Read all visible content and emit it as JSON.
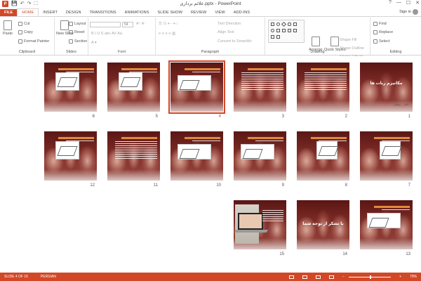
{
  "app": {
    "icon_letter": "P",
    "window_title": "علائم برداری.pptx - PowerPoint",
    "controls": [
      "?",
      "—",
      "☐",
      "✕"
    ]
  },
  "qat": [
    "💾",
    "↶",
    "↷",
    "⛶"
  ],
  "tabs": {
    "file": "FILE",
    "items": [
      "HOME",
      "INSERT",
      "DESIGN",
      "TRANSITIONS",
      "ANIMATIONS",
      "SLIDE SHOW",
      "REVIEW",
      "VIEW",
      "ADD-INS"
    ],
    "active": "HOME",
    "signin": "Sign in"
  },
  "ribbon": {
    "clipboard": {
      "label": "Clipboard",
      "paste": "Paste",
      "cut": "Cut",
      "copy": "Copy",
      "format_painter": "Format Painter"
    },
    "slides": {
      "label": "Slides",
      "new_slide": "New Slide",
      "layout": "Layout",
      "reset": "Reset",
      "section": "Section"
    },
    "font": {
      "label": "Font",
      "size": "54"
    },
    "paragraph": {
      "label": "Paragraph",
      "text_direction": "Text Direction",
      "align_text": "Align Text",
      "convert_smartart": "Convert to SmartArt"
    },
    "drawing": {
      "label": "Drawing",
      "arrange": "Arrange",
      "quick_styles": "Quick Styles",
      "shape_fill": "Shape Fill",
      "shape_outline": "Shape Outline",
      "shape_effects": "Shape Effects"
    },
    "editing": {
      "label": "Editing",
      "find": "Find",
      "replace": "Replace",
      "select": "Select"
    }
  },
  "slides": [
    {
      "num": "1",
      "kind": "title",
      "title": "مکانیزم ربات ها",
      "subtitle": "دکتر ... رضایی"
    },
    {
      "num": "2",
      "kind": "text-title"
    },
    {
      "num": "3",
      "kind": "text"
    },
    {
      "num": "4",
      "kind": "diagram-wide",
      "selected": true
    },
    {
      "num": "5",
      "kind": "diagram-arm"
    },
    {
      "num": "6",
      "kind": "diagram"
    },
    {
      "num": "7",
      "kind": "diagram-fan"
    },
    {
      "num": "8",
      "kind": "diagram-fan"
    },
    {
      "num": "9",
      "kind": "diagram-wide"
    },
    {
      "num": "10",
      "kind": "diagram-wide"
    },
    {
      "num": "11",
      "kind": "text"
    },
    {
      "num": "12",
      "kind": "diagram"
    },
    {
      "num": "13",
      "kind": "diagram-wide"
    },
    {
      "num": "14",
      "kind": "title-mid",
      "title": "با تشکر از توجه شما"
    },
    {
      "num": "15",
      "kind": "laptop"
    }
  ],
  "status": {
    "slide_info": "SLIDE 4 OF 15",
    "language": "PERSIAN",
    "zoom": "70%"
  }
}
